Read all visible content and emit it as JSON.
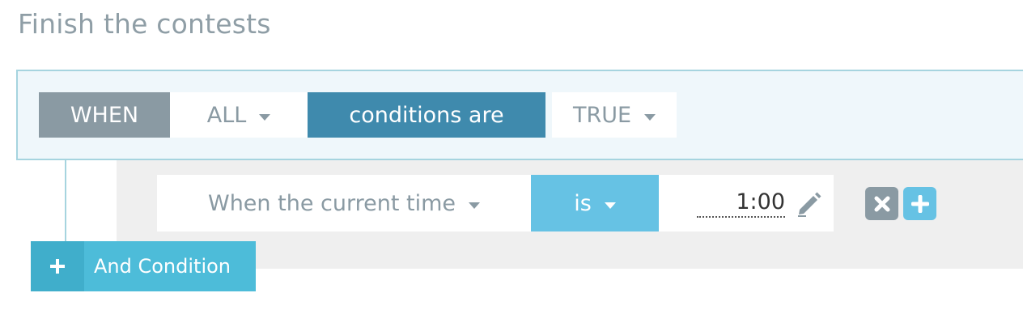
{
  "page": {
    "title": "Finish the contests"
  },
  "when_block": {
    "when_label": "WHEN",
    "quantifier": "ALL",
    "conditions_label": "conditions are",
    "truth_value": "TRUE"
  },
  "condition": {
    "field": "When the current time",
    "operator": "is",
    "value": "1:00"
  },
  "actions": {
    "and_condition_label": "And Condition"
  },
  "colors": {
    "when_gray": "#8a9aa3",
    "conditions_dark_blue": "#3f8aad",
    "operator_light_blue": "#66c2e4",
    "and_button_blue": "#4dbcd9",
    "panel_bg": "#eff7fb",
    "panel_border": "#a6d4df"
  },
  "icons": {
    "dropdown": "caret-down-icon",
    "edit": "pencil-icon",
    "remove": "x-icon",
    "add": "plus-icon"
  }
}
